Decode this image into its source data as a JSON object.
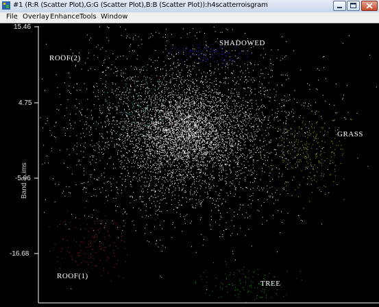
{
  "window": {
    "title": "#1 (R:R (Scatter Plot),G:G (Scatter Plot),B:B (Scatter Plot)):h4scatterroisgram"
  },
  "menu": [
    "File",
    "Overlay",
    "Enhance",
    "Tools",
    "Window"
  ],
  "colors": {
    "plot_background": "#000000",
    "points_main": "#ffffff",
    "roof2": "#2aa9a9",
    "shadowed": "#2a2ac8",
    "grass": "#b8b800",
    "roof1": "#c82a2a",
    "tree": "#1aa81a"
  },
  "chart_data": {
    "type": "scatter",
    "ylabel": "Band 3 .ims",
    "y_ticks": [
      "15.46",
      "4.75",
      "-5.96",
      "-16.68"
    ],
    "ylim": [
      -21.9,
      15.46
    ],
    "region_labels": [
      "ROOF(2)",
      "SHADOWED",
      "GRASS",
      "ROOF(1)",
      "TREE"
    ],
    "clusters": [
      {
        "name": "main",
        "x": 0.43,
        "y": 0.38,
        "sx": 0.17,
        "sy": 0.16,
        "count": 3800
      },
      {
        "name": "core",
        "x": 0.43,
        "y": 0.38,
        "sx": 0.08,
        "sy": 0.07,
        "count": 2200
      },
      {
        "name": "roof2",
        "x": 0.29,
        "y": 0.28,
        "sx": 0.05,
        "sy": 0.06,
        "count": 160
      },
      {
        "name": "shadowed",
        "x": 0.5,
        "y": 0.1,
        "sx": 0.05,
        "sy": 0.02,
        "count": 140
      },
      {
        "name": "grass",
        "x": 0.8,
        "y": 0.46,
        "sx": 0.05,
        "sy": 0.07,
        "count": 220
      },
      {
        "name": "roof1",
        "x": 0.16,
        "y": 0.78,
        "sx": 0.06,
        "sy": 0.06,
        "count": 140
      },
      {
        "name": "tree",
        "x": 0.6,
        "y": 0.93,
        "sx": 0.06,
        "sy": 0.04,
        "count": 120
      }
    ]
  }
}
